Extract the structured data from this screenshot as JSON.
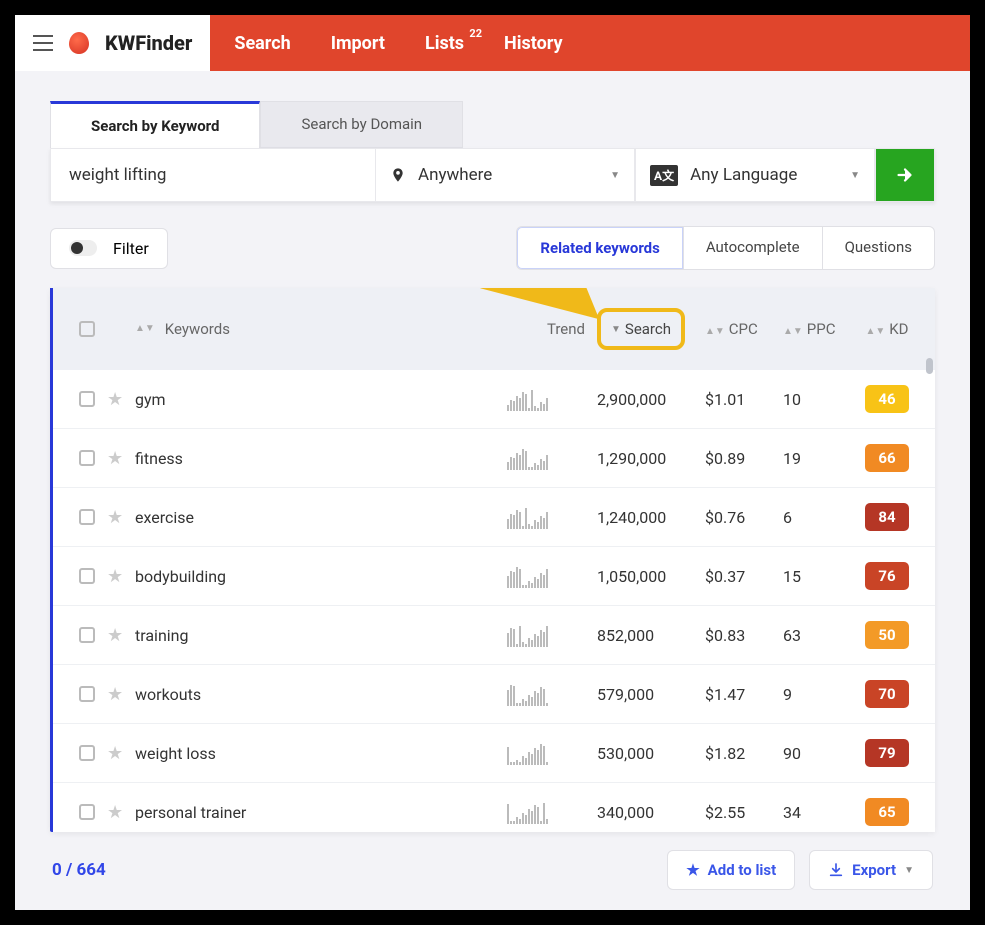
{
  "header": {
    "logo": "KWFinder",
    "nav": {
      "search": "Search",
      "import": "Import",
      "lists": "Lists",
      "lists_badge": "22",
      "history": "History"
    }
  },
  "tabs": {
    "by_keyword": "Search by Keyword",
    "by_domain": "Search by Domain"
  },
  "search": {
    "keyword_value": "weight lifting",
    "location": "Anywhere",
    "language": "Any Language"
  },
  "filter": {
    "label": "Filter"
  },
  "result_tabs": {
    "related": "Related keywords",
    "autocomplete": "Autocomplete",
    "questions": "Questions"
  },
  "columns": {
    "keywords": "Keywords",
    "trend": "Trend",
    "search": "Search",
    "cpc": "CPC",
    "ppc": "PPC",
    "kd": "KD"
  },
  "rows": [
    {
      "kw": "gym",
      "search": "2,900,000",
      "cpc": "$1.01",
      "ppc": "10",
      "kd": "46",
      "kd_color": "#f8c316"
    },
    {
      "kw": "fitness",
      "search": "1,290,000",
      "cpc": "$0.89",
      "ppc": "19",
      "kd": "66",
      "kd_color": "#f18a23"
    },
    {
      "kw": "exercise",
      "search": "1,240,000",
      "cpc": "$0.76",
      "ppc": "6",
      "kd": "84",
      "kd_color": "#b53625"
    },
    {
      "kw": "bodybuilding",
      "search": "1,050,000",
      "cpc": "$0.37",
      "ppc": "15",
      "kd": "76",
      "kd_color": "#c94426"
    },
    {
      "kw": "training",
      "search": "852,000",
      "cpc": "$0.83",
      "ppc": "63",
      "kd": "50",
      "kd_color": "#f39a27"
    },
    {
      "kw": "workouts",
      "search": "579,000",
      "cpc": "$1.47",
      "ppc": "9",
      "kd": "70",
      "kd_color": "#c94426"
    },
    {
      "kw": "weight loss",
      "search": "530,000",
      "cpc": "$1.82",
      "ppc": "90",
      "kd": "79",
      "kd_color": "#b53625"
    },
    {
      "kw": "personal trainer",
      "search": "340,000",
      "cpc": "$2.55",
      "ppc": "34",
      "kd": "65",
      "kd_color": "#f18a23"
    }
  ],
  "footer": {
    "selected": "0",
    "divider": " / ",
    "total": "664",
    "add_to_list": "Add to list",
    "export": "Export"
  }
}
